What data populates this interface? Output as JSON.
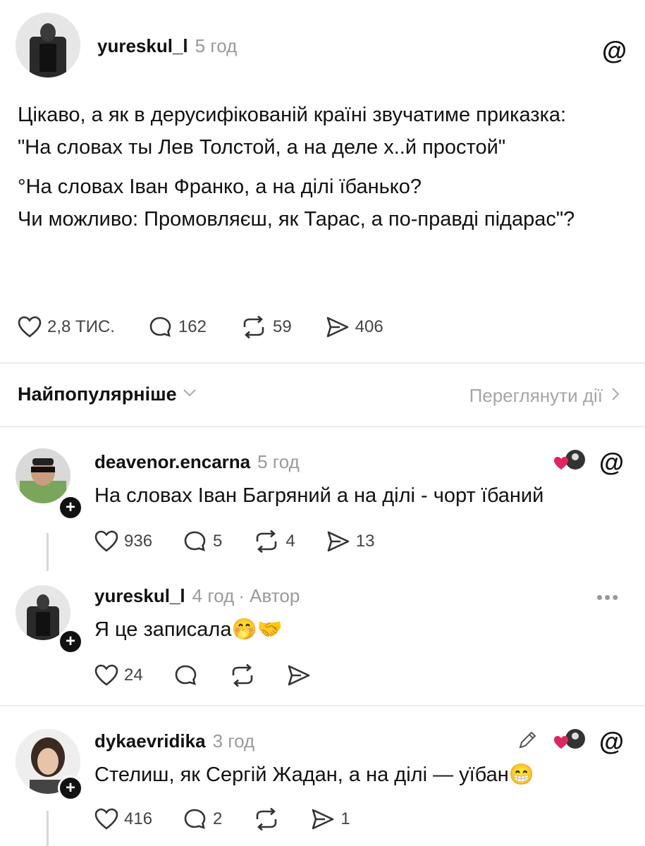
{
  "main_post": {
    "username": "yureskul_l",
    "time": "5 год",
    "paragraph1": "Цікаво, а як в дерусифікованій країні звучатиме приказка: \"На словах ты Лев Толстой, а на деле х..й простой\"",
    "line2": "°На словах Іван Франко, а на ділі їбанько?",
    "line3": "Чи можливо: Промовляєш, як Тарас, а по-правді підарас\"?",
    "likes": "2,8 ТИС.",
    "comments": "162",
    "reposts": "59",
    "shares": "406"
  },
  "sort_bar": {
    "sort_label": "Найпопулярніше",
    "view_activity": "Переглянути дії"
  },
  "replies": [
    {
      "username": "deavenor.encarna",
      "time": "5 год",
      "text": "На словах Іван Багряний а на ділі - чорт їбаний",
      "likes": "936",
      "comments": "5",
      "reposts": "4",
      "shares": "13"
    },
    {
      "username": "yureskul_l",
      "time": "4 год",
      "author_tag": "· Автор",
      "text": "Я це записала",
      "emoji": "🤭🤝",
      "likes": "24"
    },
    {
      "username": "dykaevridika",
      "time": "3 год",
      "text": "Стелиш, як Сергій Жадан, а на ділі — уїбан",
      "emoji": "😁",
      "likes": "416",
      "comments": "2",
      "shares": "1"
    }
  ],
  "icons": {
    "threads": "threads-icon",
    "heart": "heart-icon",
    "comment": "comment-icon",
    "repost": "repost-icon",
    "share": "share-icon"
  },
  "colors": {
    "text": "#111111",
    "muted": "#9a9a9a",
    "divider": "#ececec",
    "heart_red": "#e0245e"
  }
}
